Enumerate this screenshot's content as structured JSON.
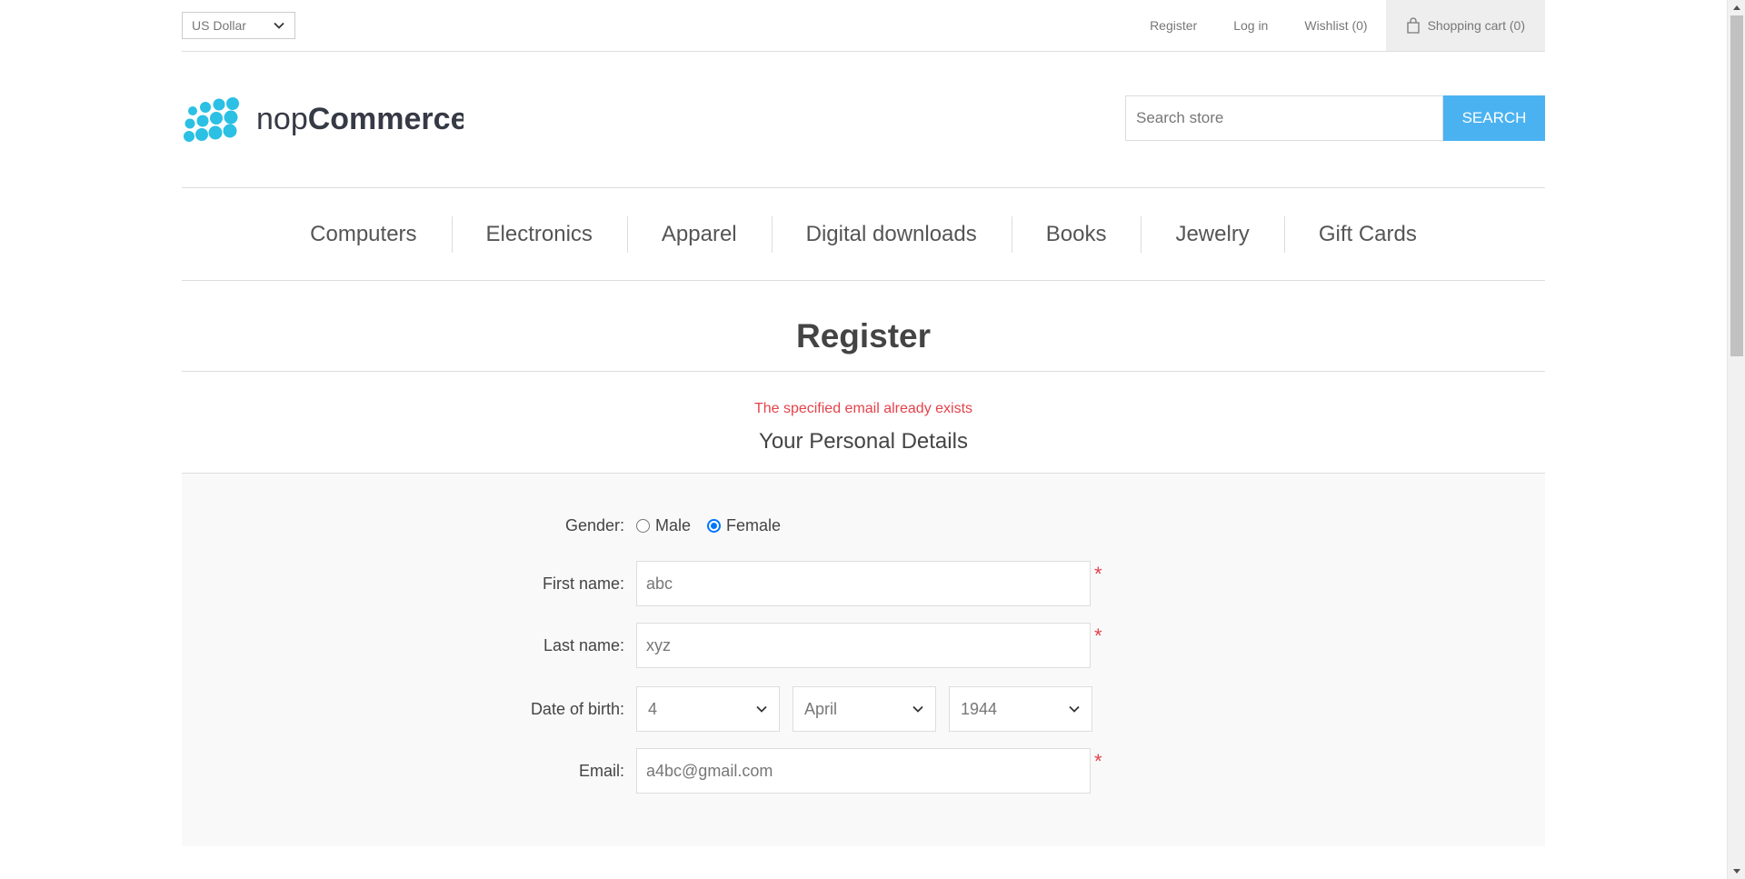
{
  "header": {
    "currency": "US Dollar",
    "links": {
      "register": "Register",
      "login": "Log in",
      "wishlist": "Wishlist (0)",
      "cart": "Shopping cart (0)"
    }
  },
  "logo": {
    "part1": "nop",
    "part2": "Commerce",
    "dot_color": "#2bc0e4",
    "text_color": "#363a46"
  },
  "search": {
    "placeholder": "Search store",
    "button": "SEARCH"
  },
  "nav": [
    "Computers",
    "Electronics",
    "Apparel",
    "Digital downloads",
    "Books",
    "Jewelry",
    "Gift Cards"
  ],
  "page": {
    "title": "Register",
    "error": "The specified email already exists",
    "section_title": "Your Personal Details"
  },
  "form": {
    "gender_label": "Gender:",
    "gender_options": [
      "Male",
      "Female"
    ],
    "gender_selected": "Female",
    "first_name_label": "First name:",
    "first_name_value": "abc",
    "last_name_label": "Last name:",
    "last_name_value": "xyz",
    "dob_label": "Date of birth:",
    "dob_day": "4",
    "dob_month": "April",
    "dob_year": "1944",
    "email_label": "Email:",
    "email_value": "a4bc@gmail.com",
    "required_mark": "*"
  },
  "colors": {
    "accent": "#4ab2f1",
    "error": "#e4434b",
    "radio": "#0075ff"
  }
}
